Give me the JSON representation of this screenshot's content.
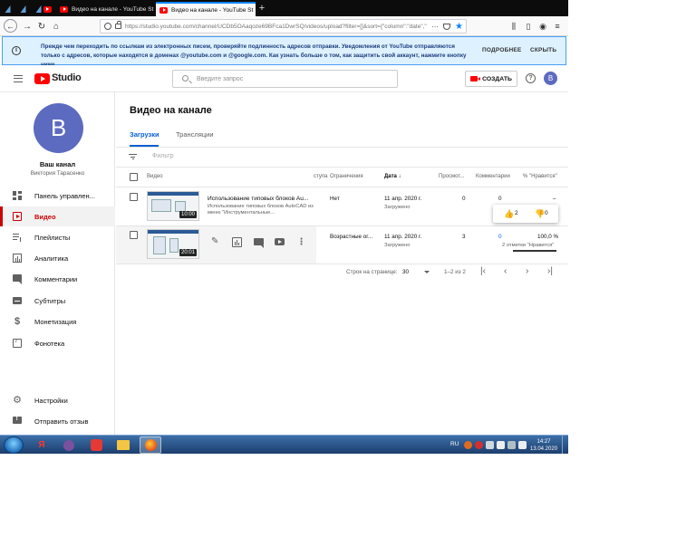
{
  "browser": {
    "tabs": [
      {
        "label": "Видео на канале - YouTube St"
      },
      {
        "label": "Видео на канале - YouTube St"
      }
    ],
    "url": "https://studio.youtube.com/channel/UCDb5OAaqoze69BFca1DwrSQ/videos/upload?filter=[]&sort={\"column\":\"date\",\"sortOrder\":\"DESCENDING\"}",
    "more_icon": "···"
  },
  "banner": {
    "text": "Прежде чем переходить по ссылкам из электронных писем, проверяйте подлинность адресов отправки. Уведомления от YouTube отправляются только с адресов, которые находятся в доменах @youtube.com и @google.com. Как узнать больше о том, как защитить свой аккаунт, нажмите кнопку ниже.",
    "details_label": "ПОДРОБНЕЕ",
    "hide_label": "СКРЫТЬ"
  },
  "header": {
    "logo_text": "Studio",
    "search_placeholder": "Введите запрос",
    "create_label": "СОЗДАТЬ",
    "help_label": "?",
    "avatar_letter": "В"
  },
  "sidebar": {
    "avatar_letter": "В",
    "channel_title": "Ваш канал",
    "channel_name": "Виктория Тарасенко",
    "items": [
      {
        "label": "Панель управлен..."
      },
      {
        "label": "Видео"
      },
      {
        "label": "Плейлисты"
      },
      {
        "label": "Аналитика"
      },
      {
        "label": "Комментарии"
      },
      {
        "label": "Субтитры"
      },
      {
        "label": "Монетизация"
      },
      {
        "label": "Фонотека"
      }
    ],
    "bottom_items": [
      {
        "label": "Настройки"
      },
      {
        "label": "Отправить отзыв"
      }
    ],
    "money_symbol": "$",
    "gear_symbol": "⚙"
  },
  "main": {
    "title": "Видео на канале",
    "tabs": [
      {
        "label": "Загрузки"
      },
      {
        "label": "Трансляции"
      }
    ],
    "filter_placeholder": "Фильтр",
    "columns": {
      "video": "Видео",
      "access": "ступа",
      "restrictions": "Ограничения",
      "date": "Дата ↓",
      "views": "Просмот...",
      "comments": "Комментарии",
      "likes": "% \"Нравится\""
    },
    "rows": [
      {
        "title": "Использование типовых блоков Au...",
        "description": "Использование типовых блоков AutoCAD из меню \"Инструментальные...",
        "duration": "10:00",
        "restrictions": "Нет",
        "date": "11 апр. 2020 г.",
        "status": "Загружено",
        "views": "0",
        "comments": "0",
        "likes": "–"
      },
      {
        "duration": "20:01",
        "restrictions": "Возрастные ог...",
        "date": "11 апр. 2020 г.",
        "status": "Загружено",
        "views": "3",
        "comments": "0",
        "likes": "100,0 %",
        "likes_sub": "2 отметки \"Нравится\""
      }
    ],
    "likes_popup": {
      "up": "2",
      "down": "0"
    },
    "pager": {
      "rows_label": "Строк на странице:",
      "rows_value": "30",
      "range": "1–2 из 2"
    }
  },
  "taskbar": {
    "lang": "RU",
    "time": "14:27",
    "date": "13.04.2020",
    "yandex_letter": "Я"
  }
}
